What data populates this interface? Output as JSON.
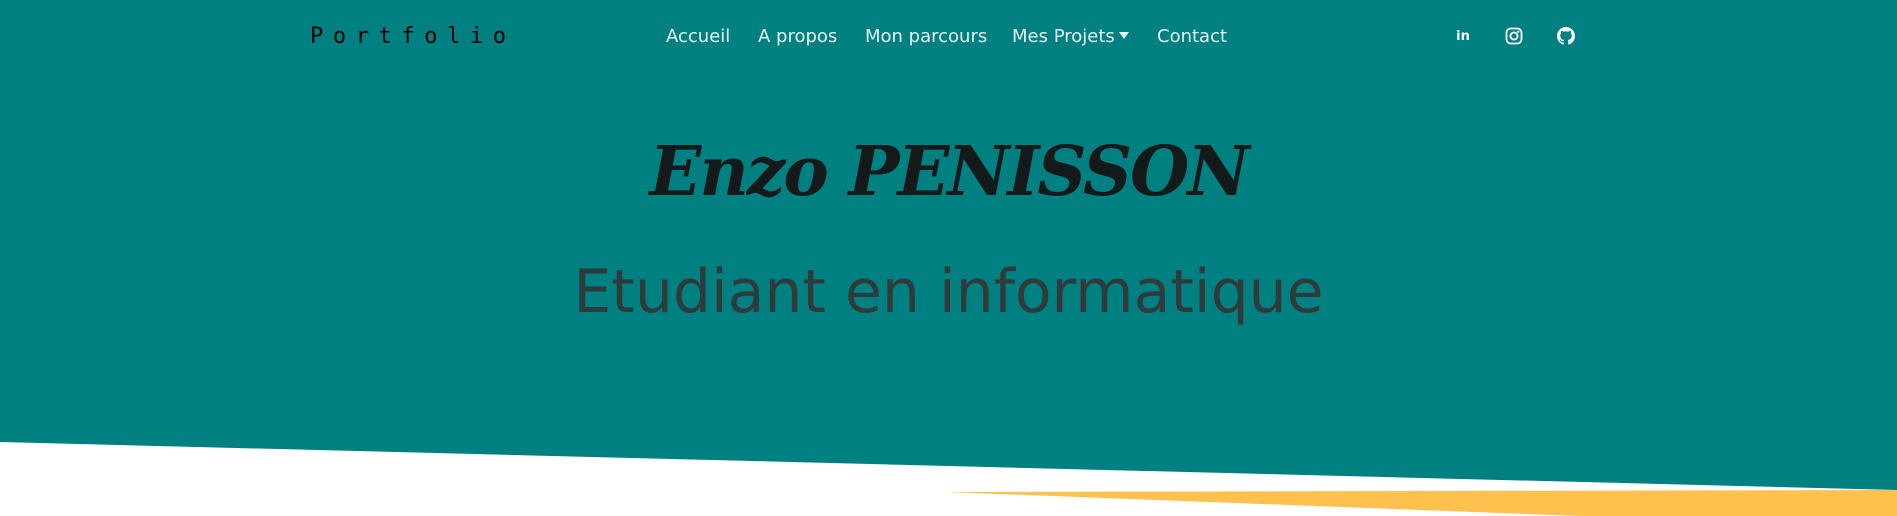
{
  "colors": {
    "hero_background": "#008080",
    "page_background": "#ffffff",
    "accent_stripe": "#ffc14d",
    "nav_text": "#e8f4f4",
    "name_text": "#14191a",
    "subtitle_text": "#2f3a3b"
  },
  "navbar": {
    "brand": "Portfolio",
    "links": [
      {
        "label": "Accueil"
      },
      {
        "label": "A propos"
      },
      {
        "label": "Mon parcours"
      },
      {
        "label": "Mes Projets",
        "dropdown": true
      },
      {
        "label": "Contact"
      }
    ],
    "social": [
      {
        "icon": "linkedin-icon",
        "glyph": "in"
      },
      {
        "icon": "instagram-icon"
      },
      {
        "icon": "github-icon"
      }
    ]
  },
  "hero": {
    "name": "Enzo PENISSON",
    "subtitle": "Etudiant en informatique"
  }
}
